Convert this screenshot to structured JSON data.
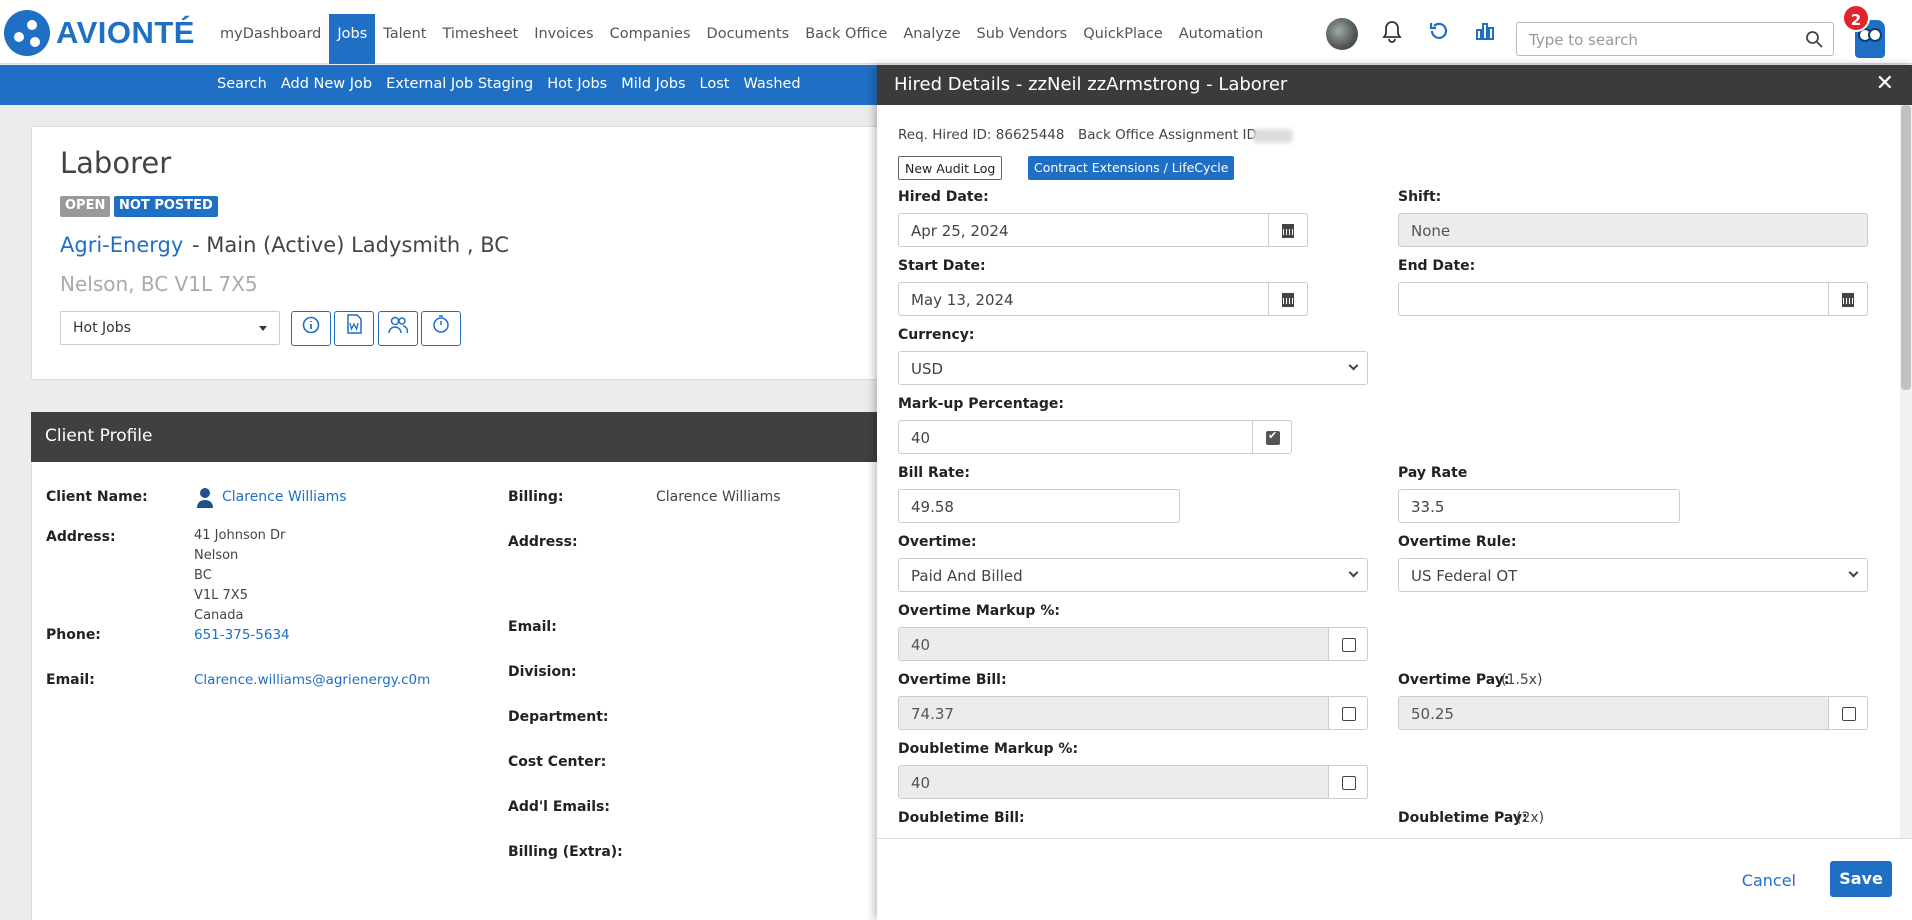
{
  "brand": {
    "name": "AVIONTÉ",
    "color": "#1f6fc5"
  },
  "nav": {
    "items": [
      "myDashboard",
      "Jobs",
      "Talent",
      "Timesheet",
      "Invoices",
      "Companies",
      "Documents",
      "Back Office",
      "Analyze",
      "Sub Vendors",
      "QuickPlace",
      "Automation"
    ],
    "active": "Jobs"
  },
  "search": {
    "placeholder": "Type to search"
  },
  "notifications": {
    "count": "2"
  },
  "subnav": {
    "items": [
      "Search",
      "Add New Job",
      "External Job Staging",
      "Hot Jobs",
      "Mild Jobs",
      "Lost",
      "Washed"
    ]
  },
  "job": {
    "title": "Laborer",
    "status_open": "OPEN",
    "status_posted": "NOT POSTED",
    "company": "Agri-Energy",
    "branch": "- Main (Active) Ladysmith , BC",
    "location": "Nelson, BC V1L 7X5",
    "list_select": "Hot Jobs"
  },
  "client_profile": {
    "header": "Client Profile",
    "client_name_label": "Client Name:",
    "client_name": "Clarence Williams",
    "address_label": "Address:",
    "address_lines": [
      "41 Johnson Dr",
      "Nelson",
      "BC",
      "V1L 7X5",
      "Canada"
    ],
    "phone_label": "Phone:",
    "phone": "651-375-5634",
    "email_label": "Email:",
    "email": "Clarence.williams@agrienergy.c0m",
    "billing_label": "Billing:",
    "billing": "Clarence Williams",
    "billing_address_label": "Address:",
    "billing_email_label": "Email:",
    "division_label": "Division:",
    "department_label": "Department:",
    "cost_center_label": "Cost Center:",
    "addl_emails_label": "Add'l Emails:",
    "billing_extra_label": "Billing (Extra):"
  },
  "modal": {
    "title": "Hired Details - zzNeil zzArmstrong - Laborer",
    "req_hired_id": "Req. Hired ID: 86625448",
    "back_office_label": "Back Office Assignment ID:",
    "audit_btn": "New Audit Log",
    "contract_btn": "Contract Extensions / LifeCycle",
    "hired_date_label": "Hired Date:",
    "hired_date": "Apr 25, 2024",
    "shift_label": "Shift:",
    "shift": "None",
    "start_date_label": "Start Date:",
    "start_date": "May 13, 2024",
    "end_date_label": "End Date:",
    "end_date": "",
    "currency_label": "Currency:",
    "currency": "USD",
    "markup_label": "Mark-up Percentage:",
    "markup": "40",
    "bill_rate_label": "Bill Rate:",
    "bill_rate": "49.58",
    "pay_rate_label": "Pay Rate",
    "pay_rate": "33.5",
    "overtime_label": "Overtime:",
    "overtime": "Paid And Billed",
    "overtime_rule_label": "Overtime Rule:",
    "overtime_rule": "US Federal OT",
    "ot_markup_label": "Overtime Markup %:",
    "ot_markup": "40",
    "ot_bill_label": "Overtime Bill:",
    "ot_bill": "74.37",
    "ot_pay_label": "Overtime Pay:",
    "ot_pay_mult": "(1.5x)",
    "ot_pay": "50.25",
    "dt_markup_label": "Doubletime Markup %:",
    "dt_markup": "40",
    "dt_bill_label": "Doubletime Bill:",
    "dt_pay_label": "Doubletime Pay:",
    "dt_pay_mult": "(2x)",
    "cancel": "Cancel",
    "save": "Save"
  }
}
